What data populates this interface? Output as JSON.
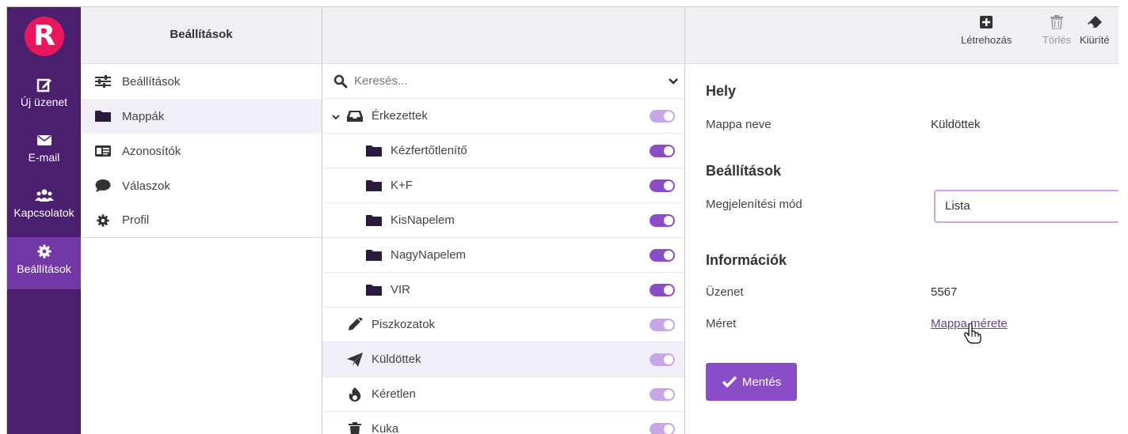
{
  "app": {
    "logo_letter": "R",
    "brand_color": "#e8175d",
    "nav_bg": "#4a1f6e",
    "accent": "#8b4dc7"
  },
  "nav": {
    "items": [
      {
        "label": "Új üzenet",
        "icon": "edit-icon"
      },
      {
        "label": "E-mail",
        "icon": "envelope-icon"
      },
      {
        "label": "Kapcsolatok",
        "icon": "users-icon"
      },
      {
        "label": "Beállítások",
        "icon": "gear-icon",
        "active": true
      }
    ]
  },
  "settings_menu": {
    "title": "Beállítások",
    "items": [
      {
        "label": "Beállítások",
        "icon": "sliders-icon"
      },
      {
        "label": "Mappák",
        "icon": "folder-icon",
        "active": true
      },
      {
        "label": "Azonosítók",
        "icon": "id-card-icon"
      },
      {
        "label": "Válaszok",
        "icon": "comment-icon"
      },
      {
        "label": "Profil",
        "icon": "gear-icon"
      }
    ]
  },
  "folders": {
    "search_placeholder": "Keresés...",
    "list": [
      {
        "label": "Érkezettek",
        "icon": "inbox-icon",
        "subscribed": true
      },
      {
        "label": "Kézfertőtlenítő",
        "icon": "folder-icon",
        "subscribed": true
      },
      {
        "label": "K+F",
        "icon": "folder-icon",
        "subscribed": true
      },
      {
        "label": "KisNapelem",
        "icon": "folder-icon",
        "subscribed": true
      },
      {
        "label": "NagyNapelem",
        "icon": "folder-icon",
        "subscribed": true
      },
      {
        "label": "VIR",
        "icon": "folder-icon",
        "subscribed": true
      },
      {
        "label": "Piszkozatok",
        "icon": "pencil-icon",
        "subscribed": true
      },
      {
        "label": "Küldöttek",
        "icon": "paper-plane-icon",
        "subscribed": true,
        "active": true
      },
      {
        "label": "Kéretlen",
        "icon": "fire-icon",
        "subscribed": true
      },
      {
        "label": "Kuka",
        "icon": "trash-icon",
        "subscribed": true
      }
    ]
  },
  "toolbar": {
    "create_label": "Létrehozás",
    "delete_label": "Törlés",
    "empty_label": "Kiüríté"
  },
  "details": {
    "section_location": "Hely",
    "folder_name_label": "Mappa neve",
    "folder_name_value": "Küldöttek",
    "section_settings": "Beállítások",
    "view_mode_label": "Megjelenítési mód",
    "view_mode_value": "Lista",
    "section_info": "Információk",
    "messages_label": "Üzenet",
    "messages_value": "5567",
    "size_label": "Méret",
    "size_link": "Mappa mérete",
    "save_label": "Mentés"
  }
}
